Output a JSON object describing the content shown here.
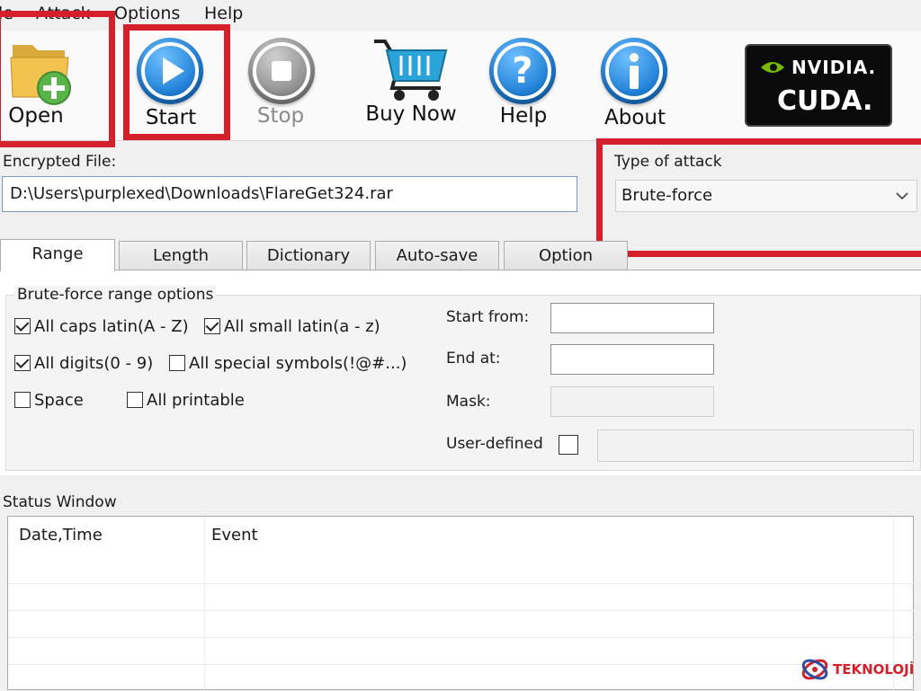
{
  "menu": {
    "items": [
      "le",
      "Attack",
      "Options",
      "Help"
    ]
  },
  "toolbar": {
    "open": "Open",
    "start": "Start",
    "stop": "Stop",
    "buy_now": "Buy Now",
    "help": "Help",
    "about": "About",
    "nvidia_brand": "NVIDIA.",
    "cuda": "CUDA."
  },
  "file": {
    "label": "Encrypted File:",
    "value": "D:\\Users\\purplexed\\Downloads\\FlareGet324.rar"
  },
  "attack": {
    "label": "Type of attack",
    "value": "Brute-force"
  },
  "tabs": [
    "Range",
    "Length",
    "Dictionary",
    "Auto-save",
    "Option"
  ],
  "range": {
    "group_label": "Brute-force range options",
    "options": [
      {
        "label": "All caps latin(A - Z)",
        "checked": true
      },
      {
        "label": "All small latin(a - z)",
        "checked": true
      },
      {
        "label": "All digits(0 - 9)",
        "checked": true
      },
      {
        "label": "All special symbols(!@#...)",
        "checked": false
      },
      {
        "label": "Space",
        "checked": false
      },
      {
        "label": "All printable",
        "checked": false
      }
    ],
    "start_from_label": "Start from:",
    "end_at_label": "End at:",
    "mask_label": "Mask:",
    "user_defined_label": "User-defined"
  },
  "status": {
    "title": "Status Window",
    "columns": [
      "Date,Time",
      "Event"
    ]
  },
  "watermark": {
    "text": "TEKNOLOJİ"
  },
  "colors": {
    "highlight": "#d4202a",
    "accent_blue": "#1f7fd6"
  }
}
